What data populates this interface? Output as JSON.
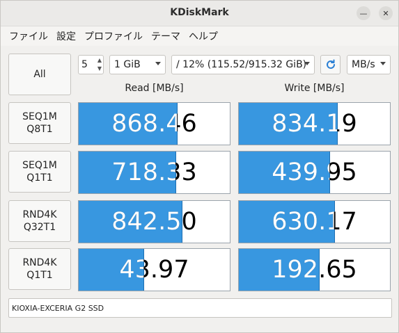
{
  "window": {
    "title": "KDiskMark"
  },
  "menu": {
    "items": [
      "ファイル",
      "設定",
      "プロファイル",
      "テーマ",
      "ヘルプ"
    ]
  },
  "controls": {
    "all_label": "All",
    "loops_value": "5",
    "size_value": "1 GiB",
    "drive_value": "/ 12% (115.52/915.32 GiB)",
    "unit_value": "MB/s",
    "refresh_icon": "refresh-icon"
  },
  "columns": {
    "read": "Read [MB/s]",
    "write": "Write [MB/s]"
  },
  "tests": [
    {
      "line1": "SEQ1M",
      "line2": "Q8T1",
      "read": "868.46",
      "write": "834.19",
      "read_fill": 0.65,
      "write_fill": 0.65
    },
    {
      "line1": "SEQ1M",
      "line2": "Q1T1",
      "read": "718.33",
      "write": "439.95",
      "read_fill": 0.64,
      "write_fill": 0.6
    },
    {
      "line1": "RND4K",
      "line2": "Q32T1",
      "read": "842.50",
      "write": "630.17",
      "read_fill": 0.68,
      "write_fill": 0.63
    },
    {
      "line1": "RND4K",
      "line2": "Q1T1",
      "read": "43.97",
      "write": "192.65",
      "read_fill": 0.43,
      "write_fill": 0.53
    }
  ],
  "footer": {
    "device": "KIOXIA-EXCERIA G2 SSD"
  },
  "colors": {
    "bar_fill": "#3897e0",
    "refresh_icon": "#2a7fd4"
  }
}
